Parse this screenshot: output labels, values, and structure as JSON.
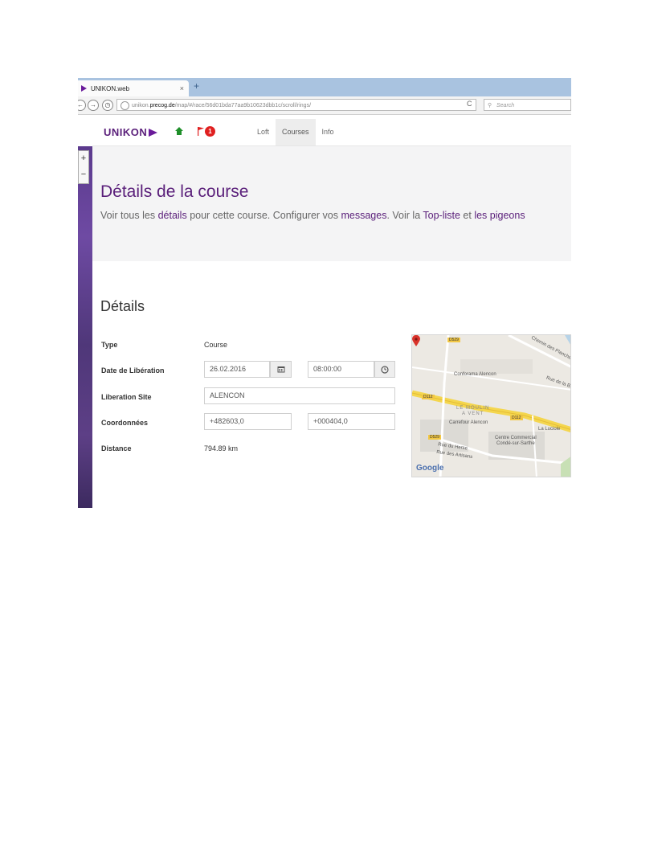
{
  "browser": {
    "tab_title": "UNIKON.web",
    "tab_close": "×",
    "new_tab": "+",
    "url_domain": "unikon.precog.de",
    "url_prefix": "unikon.",
    "url_path": "/map/#/race/56d01bda77aa9b10623dbb1c/scroll/rings/",
    "search_placeholder": "Search",
    "reload": "C"
  },
  "map_zoom": {
    "plus": "+",
    "minus": "−"
  },
  "header": {
    "brand": "UNIKON",
    "notification_count": "1",
    "menu": [
      {
        "label": "Loft"
      },
      {
        "label": "Courses",
        "active": true
      },
      {
        "label": "Info"
      }
    ]
  },
  "hero": {
    "title": "Détails de la course",
    "lead_1": "Voir tous les ",
    "link_details": "détails",
    "lead_2": " pour cette course. Configurer vos ",
    "link_messages": "messages",
    "lead_3": ". Voir la ",
    "link_top": "Top-liste",
    "lead_4": " et ",
    "link_pigeons": "les pigeons"
  },
  "details": {
    "section_title": "Détails",
    "type_label": "Type",
    "type_value": "Course",
    "date_label": "Date de Libération",
    "date_value": "26.02.2016",
    "time_value": "08:00:00",
    "site_label": "Liberation Site",
    "site_value": "ALENCON",
    "coords_label": "Coordonnées",
    "lat_value": "+482603,0",
    "lon_value": "+000404,0",
    "distance_label": "Distance",
    "distance_value": "794.89 km"
  },
  "map": {
    "road_d529": "D529",
    "road_d112": "D112",
    "road_d112b": "D112",
    "road_d529b": "D529",
    "chemin": "Chemin des Planches",
    "rue_br": "Rue de la Br",
    "conforama": "Conforama Alencon",
    "moulin": "LE MOULIN",
    "avent": "A VENT",
    "carrefour": "Carrefour Alencon",
    "luciole": "La Luciole",
    "centre": "Centre Commercial",
    "conde": "Condé-sur-Sarthe",
    "herse": "Rue du Herse",
    "artisans": "Rue des Artisans",
    "google": "Google"
  },
  "colors": {
    "brand": "#5a1f7a",
    "badge": "#e02020",
    "tabbar": "#a9c3e0"
  }
}
